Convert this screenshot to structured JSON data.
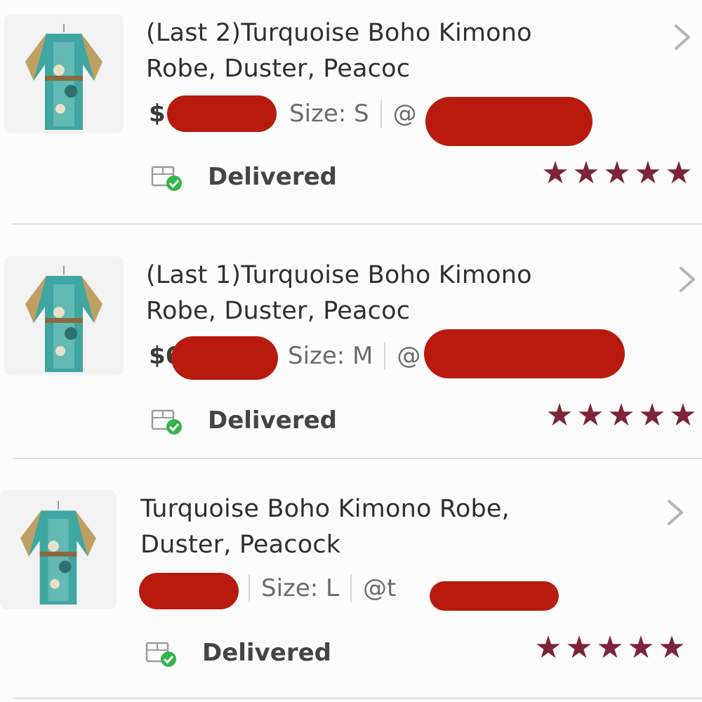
{
  "orders": [
    {
      "title_line1": "(Last 2)Turquoise Boho Kimono",
      "title_line2": "Robe, Duster, Peacoc",
      "price_prefix": "$",
      "size": "Size: S",
      "user_prefix": "@",
      "status": "Delivered",
      "rating": 5
    },
    {
      "title_line1": "(Last 1)Turquoise Boho Kimono",
      "title_line2": "Robe, Duster, Peacoc",
      "price_prefix": "$6",
      "size": "Size: M",
      "user_prefix": "@",
      "status": "Delivered",
      "rating": 5
    },
    {
      "title_line1": "Turquoise Boho Kimono Robe,",
      "title_line2": "Duster, Peacock",
      "price_prefix": "$",
      "size": "Size: L",
      "user_prefix": "@t",
      "status": "Delivered",
      "rating": 5
    }
  ],
  "colors": {
    "star": "#7d2438",
    "redaction": "#b81b0e",
    "check": "#35b44a"
  },
  "icons": {
    "thumbnail": "kimono-thumbnail",
    "status": "delivered-box-icon",
    "rating": "star-icon",
    "navigate": "chevron-right-icon"
  }
}
